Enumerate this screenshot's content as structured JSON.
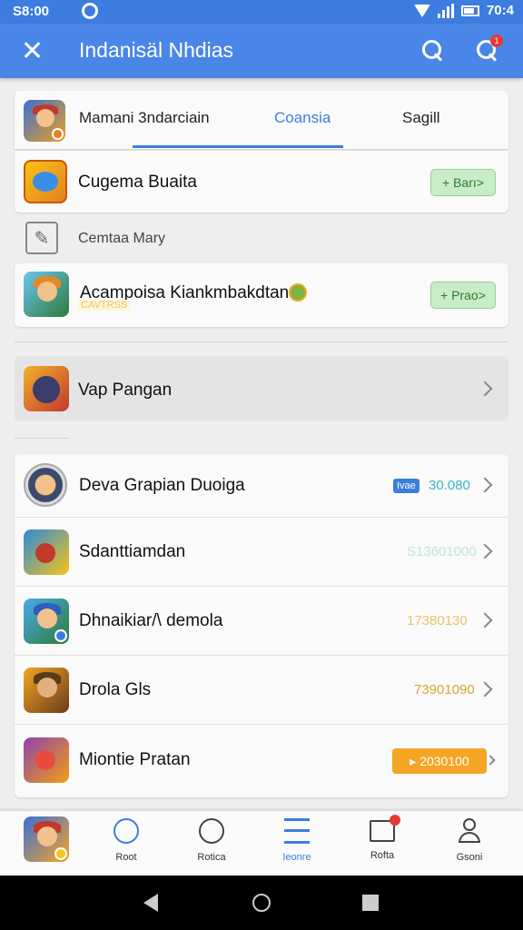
{
  "status_bar": {
    "time": "S8:00",
    "battery": "70:4"
  },
  "app_bar": {
    "title": "Indanisäl Nhdias",
    "notif_count": "1"
  },
  "tabs": [
    {
      "label": "Mamani 3ndarciain"
    },
    {
      "label": "Coansia"
    },
    {
      "label": "Sagill"
    }
  ],
  "section1": {
    "row1": {
      "label": "Cugema Buaita",
      "button": "+ Barı>"
    },
    "row2": {
      "label": "Cemtaa Mary"
    },
    "row3": {
      "label": "Acampoisa Kiankmbakdtan",
      "sublabel": "CAVTRSS",
      "button": "+ Prao>"
    }
  },
  "single_row": {
    "label": "Vap Pangan"
  },
  "list": [
    {
      "label": "Deva Grapian Duoiga",
      "tag": "Ivae",
      "value": "30.080",
      "value_color": "#3ab5c9"
    },
    {
      "label": "Sdanttiamdan",
      "value": "S13601000",
      "value_color": "#bfe8d6"
    },
    {
      "label": "Dhnaikiar/\\ demola",
      "value": "17380130",
      "value_color": "#e8c46a"
    },
    {
      "label": "Drola Gls",
      "value": "73901090",
      "value_color": "#d4a832"
    },
    {
      "label": "Miontie Pratan",
      "value": "▸ 2030100",
      "value_color": "#ffffff"
    }
  ],
  "bottom_nav": [
    {
      "label": "Root",
      "icon": "target-icon"
    },
    {
      "label": "Rotica",
      "icon": "x-circle-icon"
    },
    {
      "label": "Ieonre",
      "icon": "menu-lines-icon"
    },
    {
      "label": "Rofta",
      "icon": "mail-icon"
    },
    {
      "label": "Gsoni",
      "icon": "person-icon"
    }
  ],
  "colors": {
    "accent": "#4a86e8",
    "status_bar": "#3d7de0",
    "green_button": "#c8ecc8",
    "orange": "#f5a524"
  }
}
